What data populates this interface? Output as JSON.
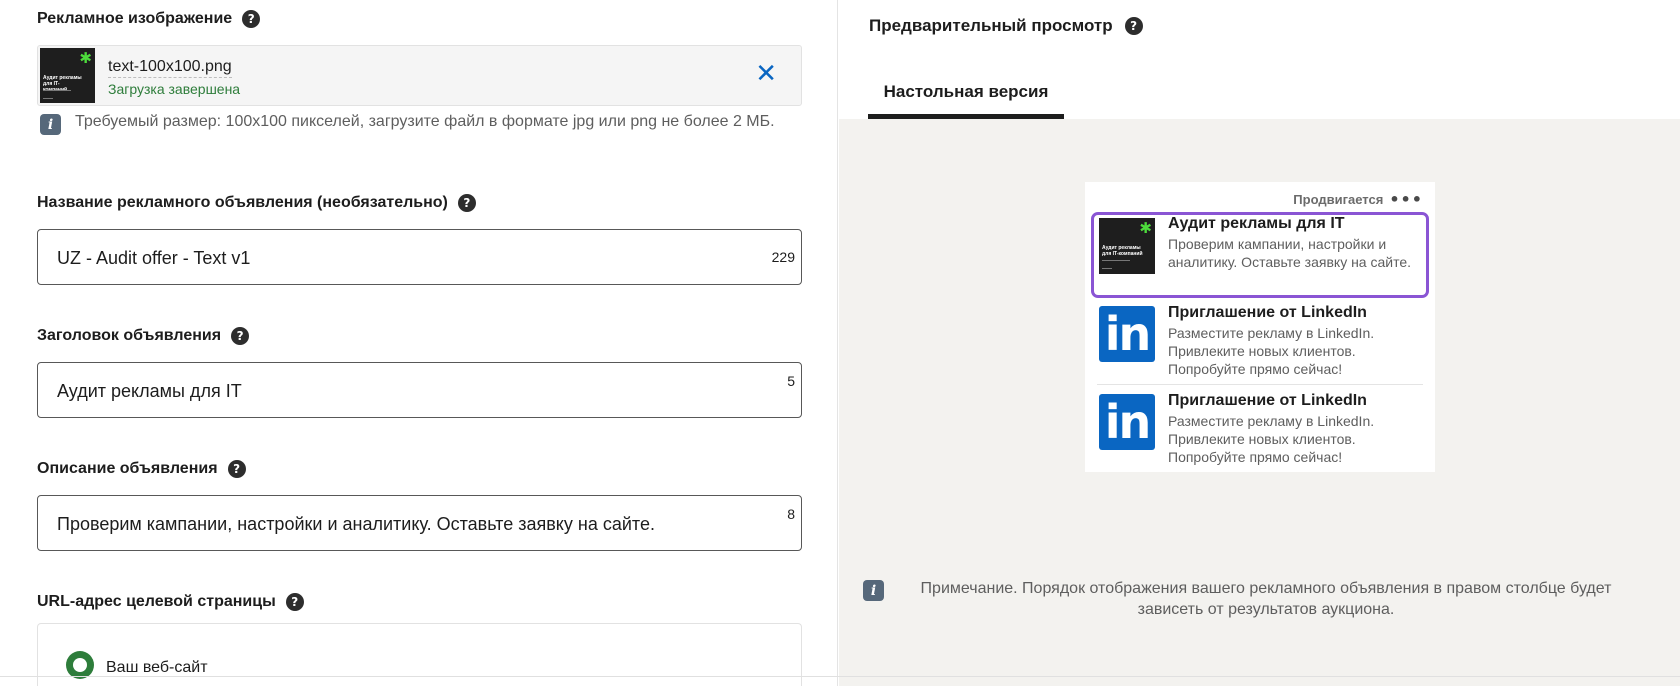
{
  "left": {
    "image_section": {
      "label": "Рекламное изображение",
      "file_name": "text-100x100.png",
      "status": "Загрузка завершена",
      "thumbnail_text": "Аудит рекламы для IT-компаний",
      "info": "Требуемый размер: 100x100 пикселей, загрузите файл в формате jpg или png не более 2 МБ."
    },
    "ad_name": {
      "label": "Название рекламного объявления (необязательно)",
      "value": "UZ - Audit offer - Text v1",
      "count": "229"
    },
    "headline": {
      "label": "Заголовок объявления",
      "value": "Аудит рекламы для IT",
      "count": "5"
    },
    "description": {
      "label": "Описание объявления",
      "value": "Проверим кампании, настройки и аналитику. Оставьте заявку на сайте.",
      "count": "8"
    },
    "url": {
      "label": "URL-адрес целевой страницы",
      "option": "Ваш веб-сайт"
    }
  },
  "right": {
    "title": "Предварительный просмотр",
    "tab": "Настольная версия",
    "card": {
      "promoted": "Продвигается",
      "items": [
        {
          "title": "Аудит рекламы для IT",
          "desc": "Проверим кампании, настройки и аналитику. Оставьте заявку на сайте.",
          "icon": "ad-thumbnail",
          "thumbnail_text": "Аудит рекламы для IT-компаний"
        },
        {
          "title": "Приглашение от LinkedIn",
          "desc": "Разместите рекламу в LinkedIn. Привлеките новых клиентов. Попробуйте прямо сейчас!",
          "icon": "linkedin-icon",
          "logo_text": "in"
        },
        {
          "title": "Приглашение от LinkedIn",
          "desc": "Разместите рекламу в LinkedIn. Привлеките новых клиентов. Попробуйте прямо сейчас!",
          "icon": "linkedin-icon",
          "logo_text": "in"
        }
      ]
    },
    "note": "Примечание. Порядок отображения вашего рекламного объявления в правом столбце будет зависеть от результатов аукциона."
  },
  "icons": {
    "help": "?",
    "info": "i",
    "close": "✕",
    "more": "•••",
    "asterisk": "✱"
  },
  "colors": {
    "accent": "#0a66c2",
    "success": "#2e7d3b",
    "selected_border": "#8a55d4"
  }
}
